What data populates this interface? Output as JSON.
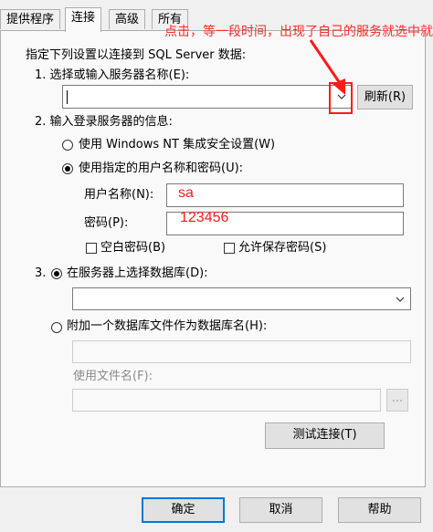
{
  "tabs": [
    "提供程序",
    "连接",
    "高级",
    "所有"
  ],
  "intro": "指定下列设置以连接到 SQL Server 数据:",
  "step1": {
    "label": "1. 选择或输入服务器名称(E):",
    "server_value": "",
    "refresh_label": "刷新(R)"
  },
  "step2": {
    "label": "2. 输入登录服务器的信息:",
    "radio_windows": "使用 Windows NT 集成安全设置(W)",
    "radio_sql": "使用指定的用户名称和密码(U):",
    "username_label": "用户名称(N):",
    "username_value": "sa",
    "password_label": "密码(P):",
    "password_value": "123456",
    "blank_password": "空白密码(B)",
    "allow_save_password": "允许保存密码(S)"
  },
  "step3": {
    "label": "3.",
    "radio_select_db": "在服务器上选择数据库(D):",
    "db_value": "",
    "radio_attach": "附加一个数据库文件作为数据库名(H):",
    "attach_value": "",
    "use_filename_label": "使用文件名(F):",
    "filename_value": "",
    "browse_label": "...",
    "test_connection": "测试连接(T)"
  },
  "footer": {
    "ok": "确定",
    "cancel": "取消",
    "help": "帮助"
  },
  "annotation": "点击，等一段时间，出现了自己的服务就选中就行",
  "colors": {
    "annotation": "#ff1a1a",
    "focus_blue": "#0078d7"
  },
  "icons": {
    "dropdown": "chevron-down-icon",
    "annotation_arrow": "arrow-icon"
  }
}
